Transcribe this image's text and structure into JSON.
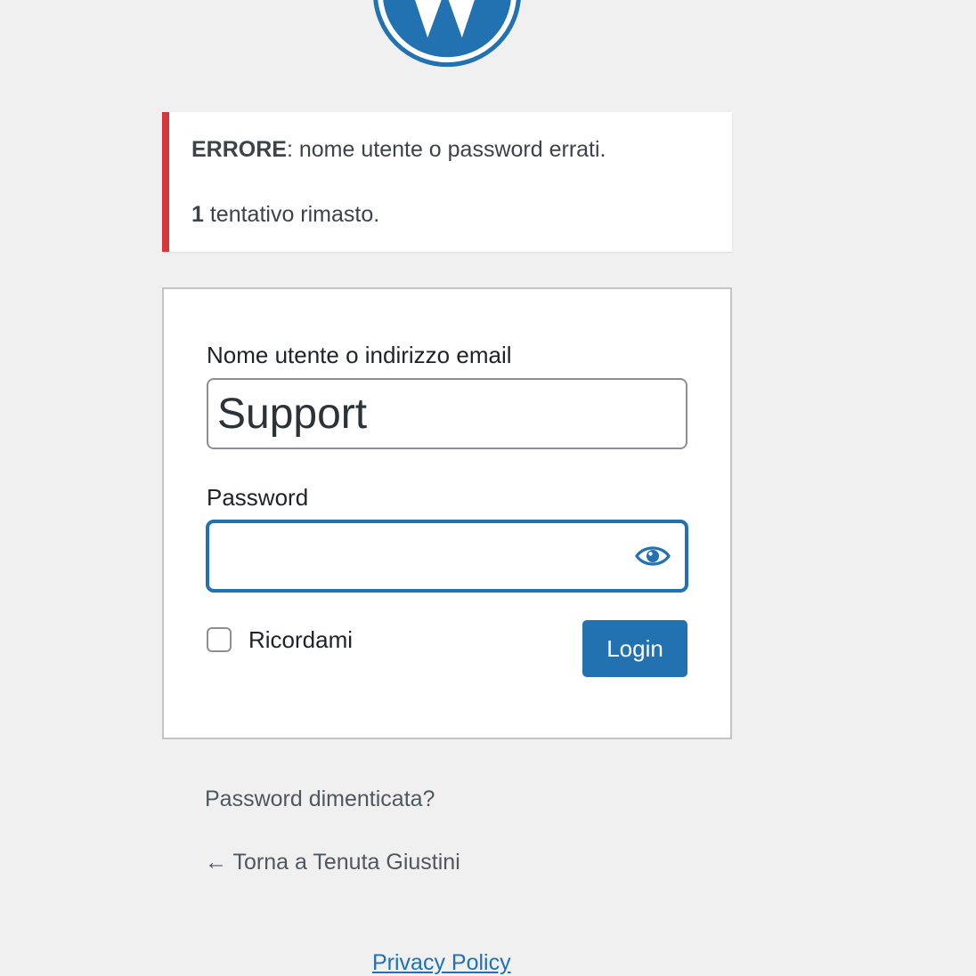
{
  "branding": {
    "logo_icon": "wordpress-logo-icon",
    "accent_color": "#2271b1"
  },
  "error_notice": {
    "error_label": "ERRORE",
    "error_message": ": nome utente o password errati.",
    "attempts_count": "1",
    "attempts_text": " tentativo rimasto.",
    "border_color": "#d63638"
  },
  "login_form": {
    "username_label": "Nome utente o indirizzo email",
    "username_value": "Support",
    "password_label": "Password",
    "password_value": "",
    "show_password_icon": "eye-icon",
    "remember_label": "Ricordami",
    "remember_checked": false,
    "login_button": "Login"
  },
  "links": {
    "lost_password": "Password dimenticata?",
    "back_to_site": "← Torna a Tenuta Giustini",
    "privacy_policy": "Privacy Policy"
  }
}
